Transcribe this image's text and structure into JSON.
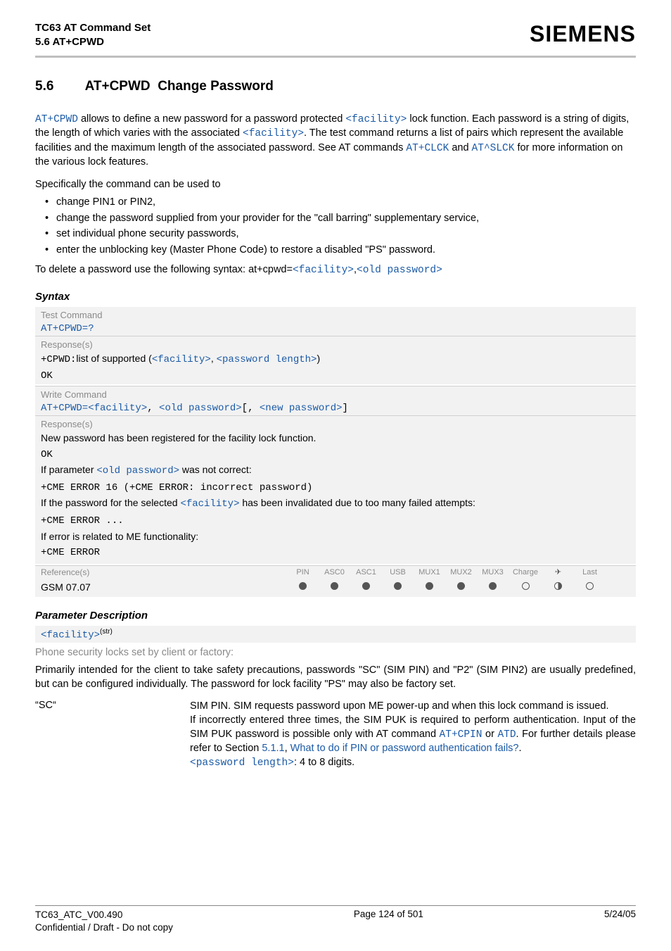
{
  "header": {
    "title": "TC63 AT Command Set",
    "subtitle": "5.6 AT+CPWD",
    "brand": "SIEMENS"
  },
  "section": {
    "number": "5.6",
    "command": "AT+CPWD",
    "title": "Change Password"
  },
  "intro": {
    "cmd1": "AT+CPWD",
    "t1": " allows to define a new password for a password protected ",
    "p_facility": "<facility>",
    "t2": " lock function. Each password is a string of digits, the length of which varies with the associated ",
    "t3": ". The test command returns a list of pairs which represent the available facilities and the maximum length of the associated password. See AT commands ",
    "cmd_clck": "AT+CLCK",
    "and": " and ",
    "cmd_slck": "AT^SLCK",
    "t4": " for more information on the various lock features."
  },
  "spec_intro": "Specifically the command can be used to",
  "bullets": [
    "change PIN1 or PIN2,",
    "change the password supplied from your provider for the \"call barring\" supplementary service,",
    "set individual phone security passwords,",
    "enter the unblocking key (Master Phone Code) to restore a disabled \"PS\" password."
  ],
  "del_line": {
    "pre": "To delete a password use the following syntax: at+cpwd=",
    "p1": "<facility>",
    "comma": ",",
    "p2": "<old password>"
  },
  "syntax_h": "Syntax",
  "test_label": "Test Command",
  "test_cmd": "AT+CPWD=?",
  "resp_label": "Response(s)",
  "test_resp": {
    "pre": "+CPWD:",
    "mid": "list of supported (",
    "p1": "<facility>",
    "sep": ", ",
    "p2": "<password length>",
    "suf": ")"
  },
  "ok": "OK",
  "write_label": "Write Command",
  "write_cmd": {
    "pre": "AT+CPWD=",
    "p1": "<facility>",
    "s1": ", ",
    "p2": "<old password>",
    "s2": "[, ",
    "p3": "<new password>",
    "s3": "]"
  },
  "write_resp": {
    "l1": "New password has been registered for the facility lock function.",
    "l2a": "If parameter ",
    "l2p": "<old password>",
    "l2b": " was not correct:",
    "l3": "+CME ERROR 16 (+CME ERROR: incorrect password)",
    "l4a": "If the password for the selected ",
    "l4p": "<facility>",
    "l4b": " has been invalidated due to too many failed attempts:",
    "l5": "+CME ERROR ...",
    "l6": "If error is related to ME functionality:",
    "l7": "+CME ERROR"
  },
  "ref": {
    "label": "Reference(s)",
    "cols": [
      "PIN",
      "ASC0",
      "ASC1",
      "USB",
      "MUX1",
      "MUX2",
      "MUX3",
      "Charge",
      "✈",
      "Last"
    ],
    "val_label": "GSM 07.07",
    "dots": [
      "full",
      "full",
      "full",
      "full",
      "full",
      "full",
      "full",
      "empty",
      "half",
      "empty"
    ]
  },
  "param_h": "Parameter Description",
  "param_name": "<facility>",
  "param_sup": "(str)",
  "param_intro": "Phone security locks set by client or factory:",
  "param_body": "Primarily intended for the client to take safety precautions, passwords \"SC\" (SIM PIN) and \"P2\" (SIM PIN2) are usually predefined, but can be configured individually. The password for lock facility \"PS\" may also be factory set.",
  "sc": {
    "key": "“SC“",
    "v1": "SIM PIN. SIM requests password upon ME power-up and when this lock command is issued.",
    "v2": "If incorrectly entered three times, the SIM PUK is required to perform authentication. Input of the SIM PUK password is possible only with AT command ",
    "cpin": "AT+CPIN",
    "or": " or ",
    "atd": "ATD",
    "v3": ". For further details please refer to Section ",
    "secnum": "5.1.1",
    "sep": ", ",
    "seclink": "What to do if PIN or password authentication fails?",
    "dot": ".",
    "pl": "<password length>",
    "pl_suf": ": 4 to 8 digits."
  },
  "footer": {
    "doc": "TC63_ATC_V00.490",
    "page": "Page 124 of 501",
    "date": "5/24/05",
    "conf": "Confidential / Draft - Do not copy"
  }
}
